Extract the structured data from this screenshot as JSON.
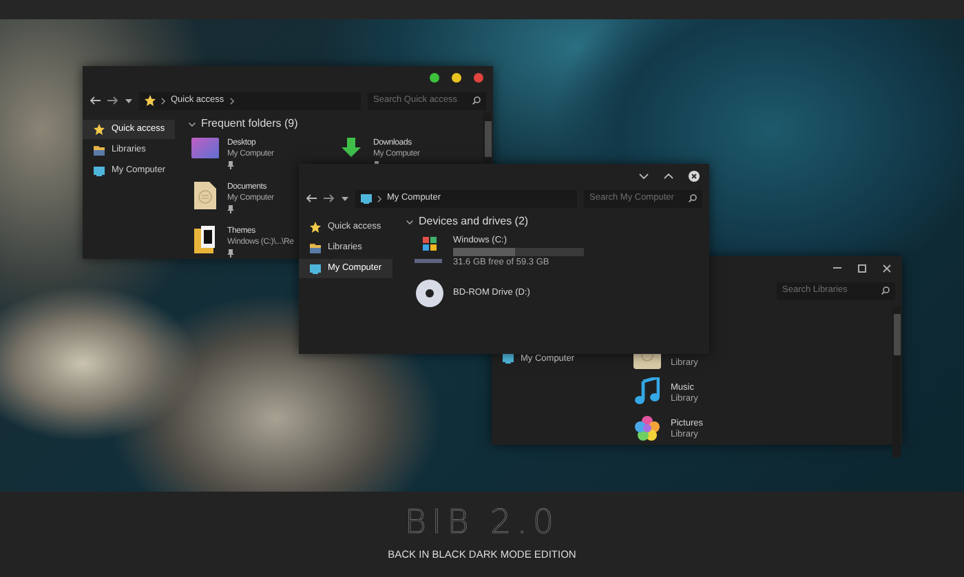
{
  "windows": [
    {
      "controls": [
        {
          "kind": "dot",
          "color": "#3cc13b"
        },
        {
          "kind": "dot",
          "color": "#e8c21f"
        },
        {
          "kind": "dot",
          "color": "#e0443e"
        }
      ],
      "address": {
        "kind": "star",
        "label": "Quick access"
      },
      "search": {
        "placeholder": "Search Quick access"
      },
      "sidebar": [
        {
          "kind": "star",
          "label": "Quick access",
          "selected": true
        },
        {
          "kind": "folder",
          "label": "Libraries",
          "selected": false
        },
        {
          "kind": "monitor",
          "label": "My Computer",
          "selected": false
        }
      ],
      "section": {
        "title": "Frequent folders (9)"
      },
      "items": [
        {
          "kind": "desktop",
          "name": "Desktop",
          "detail": "My Computer",
          "pinned": true
        },
        {
          "kind": "download",
          "name": "Downloads",
          "detail": "My Computer",
          "pinned": true
        },
        {
          "kind": "document",
          "name": "Documents",
          "detail": "My Computer",
          "pinned": true
        },
        {
          "kind": "themes",
          "name": "Themes",
          "detail": "Windows (C:)\\...\\Re",
          "pinned": true
        }
      ]
    },
    {
      "controls": [
        {
          "kind": "chevron-down"
        },
        {
          "kind": "chevron-up"
        },
        {
          "kind": "close-circle"
        }
      ],
      "address": {
        "kind": "monitor",
        "label": "My Computer"
      },
      "search": {
        "placeholder": "Search My Computer"
      },
      "sidebar": [
        {
          "kind": "star",
          "label": "Quick access",
          "selected": false
        },
        {
          "kind": "folder",
          "label": "Libraries",
          "selected": false
        },
        {
          "kind": "monitor",
          "label": "My Computer",
          "selected": true
        }
      ],
      "section": {
        "title": "Devices and drives (2)"
      },
      "items": [
        {
          "kind": "windows-drive",
          "name": "Windows (C:)",
          "level": 0.47,
          "free": "31.6 GB free of 59.3 GB"
        },
        {
          "kind": "disc",
          "name": "BD-ROM Drive (D:)"
        }
      ]
    },
    {
      "controls": [
        {
          "kind": "minimize"
        },
        {
          "kind": "maximize"
        },
        {
          "kind": "close"
        }
      ],
      "search": {
        "placeholder": "Search Libraries"
      },
      "sidebar": [
        {
          "kind": "monitor",
          "label": "My Computer",
          "selected": false
        }
      ],
      "items": [
        {
          "kind": "library-document",
          "detail": "Library"
        },
        {
          "kind": "music",
          "name": "Music",
          "detail": "Library"
        },
        {
          "kind": "pictures",
          "name": "Pictures",
          "detail": "Library"
        }
      ]
    }
  ],
  "banner": {
    "title": "BIB 2.0",
    "subtitle": "BACK IN BLACK DARK MODE EDITION"
  }
}
